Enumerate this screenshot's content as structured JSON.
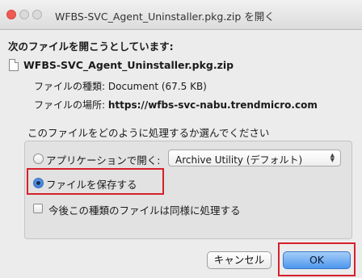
{
  "window": {
    "title": "WFBS-SVC_Agent_Uninstaller.pkg.zip を開く"
  },
  "dialog": {
    "heading": "次のファイルを開こうとしています:",
    "file_name": "WFBS-SVC_Agent_Uninstaller.pkg.zip",
    "file_type_label": "ファイルの種類:",
    "file_type_value": "Document (67.5 KB)",
    "file_location_label": "ファイルの場所:",
    "file_location_value": "https://wfbs-svc-nabu.trendmicro.com",
    "question": "このファイルをどのように処理するか選んでください",
    "options": {
      "open_with_label": "アプリケーションで開く:",
      "open_with_app": "Archive Utility (デフォルト)",
      "save_label": "ファイルを保存する",
      "remember_label": "今後この種類のファイルは同様に処理する"
    },
    "state": {
      "selected_option": "save",
      "remember_checked": false
    },
    "buttons": {
      "cancel": "キャンセル",
      "ok": "OK"
    }
  },
  "colors": {
    "highlight": "#d7202a",
    "primary_button": "#4d97ed",
    "close_button": "#f05a52"
  },
  "icons": [
    "close-icon",
    "minimize-icon",
    "zoom-icon",
    "file-icon",
    "select-arrows-icon"
  ]
}
